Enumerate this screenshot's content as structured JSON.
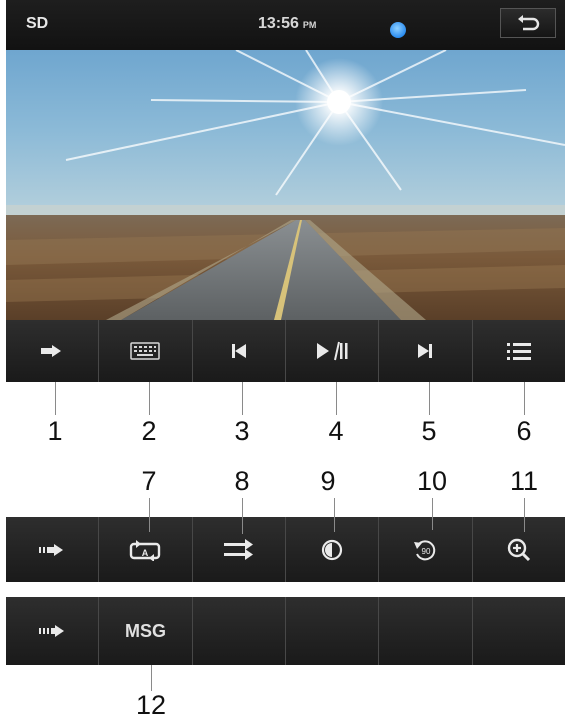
{
  "status_bar": {
    "source": "SD",
    "time": "13:56",
    "ampm": "PM",
    "status_dot_color": "#2a8cf0"
  },
  "video": {
    "content": "road-sun-photo"
  },
  "main_bar": {
    "buttons": [
      {
        "icon": "arrow-right-icon"
      },
      {
        "icon": "keyboard-icon"
      },
      {
        "icon": "previous-track-icon"
      },
      {
        "icon": "play-pause-icon"
      },
      {
        "icon": "next-track-icon"
      },
      {
        "icon": "menu-list-icon"
      }
    ]
  },
  "options_bar": {
    "buttons": [
      {
        "icon": "arrow-right-icon"
      },
      {
        "icon": "repeat-a-icon"
      },
      {
        "icon": "shuffle-icon"
      },
      {
        "icon": "brightness-icon"
      },
      {
        "icon": "rotate-90-icon",
        "text": "90"
      },
      {
        "icon": "zoom-in-icon"
      }
    ]
  },
  "extra_bar": {
    "buttons": [
      {
        "icon": "arrow-right-icon"
      },
      {
        "label": "MSG"
      },
      {},
      {},
      {},
      {}
    ]
  },
  "callouts": {
    "c1": "1",
    "c2": "2",
    "c3": "3",
    "c4": "4",
    "c5": "5",
    "c6": "6",
    "c7": "7",
    "c8": "8",
    "c9": "9",
    "c10": "10",
    "c11": "11",
    "c12": "12"
  },
  "colors": {
    "bar_background": "#1f1f1f",
    "icon": "#eaeaea",
    "callout_text": "#111111"
  }
}
